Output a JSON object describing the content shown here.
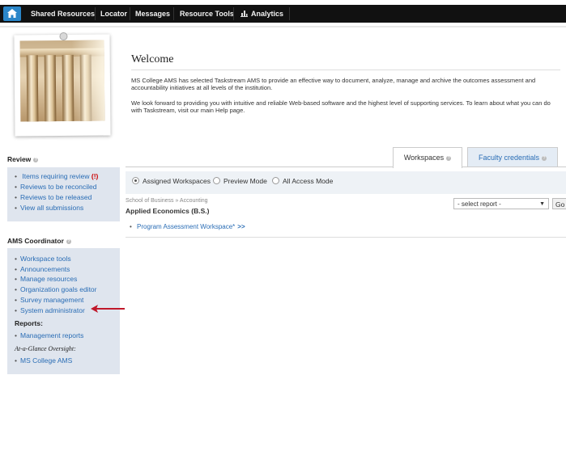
{
  "nav": {
    "home_icon": "home-icon",
    "items": [
      "Shared Resources",
      "Locator",
      "Messages",
      "Resource Tools",
      "Analytics"
    ],
    "analytics_icon": "bar-chart-icon"
  },
  "welcome": {
    "title": "Welcome",
    "p1": "MS College AMS has selected Taskstream AMS to provide an effective way to document, analyze, manage and archive the outcomes assessment and accountability initiatives at all levels of the institution.",
    "p2": "We look forward to providing you with intuitive and reliable Web-based software and the highest level of supporting services. To learn about what you can do with Taskstream, visit our main Help page."
  },
  "review": {
    "title": "Review",
    "items": [
      "Items requiring review",
      "Reviews to be reconciled",
      "Reviews to be released",
      "View all submissions"
    ],
    "flag": "(!)"
  },
  "coordinator": {
    "title": "AMS Coordinator",
    "items": [
      "Workspace tools",
      "Announcements",
      "Manage resources",
      "Organization goals editor",
      "Survey management",
      "System administrator"
    ],
    "reports_label": "Reports:",
    "reports_items": [
      "Management reports"
    ],
    "oversight_label": "At-a-Glance Oversight:",
    "oversight_items": [
      "MS College AMS"
    ]
  },
  "tabs": {
    "workspaces": "Workspaces",
    "faculty": "Faculty credentials"
  },
  "modes": {
    "options": [
      "Assigned Workspaces",
      "Preview Mode",
      "All Access Mode"
    ],
    "selected": "Assigned Workspaces"
  },
  "workspace": {
    "breadcrumb": "School of Business » Accounting",
    "program": "Applied Economics (B.S.)",
    "item": "Program Assessment Workspace*",
    "more": ">>",
    "report_select": "- select report -",
    "go": "Go"
  },
  "colors": {
    "nav_bg": "#111111",
    "home_accent": "#2a86c9",
    "link": "#2a6db5",
    "sidebox_bg": "#dfe5ee",
    "arrow": "#c0182a"
  }
}
